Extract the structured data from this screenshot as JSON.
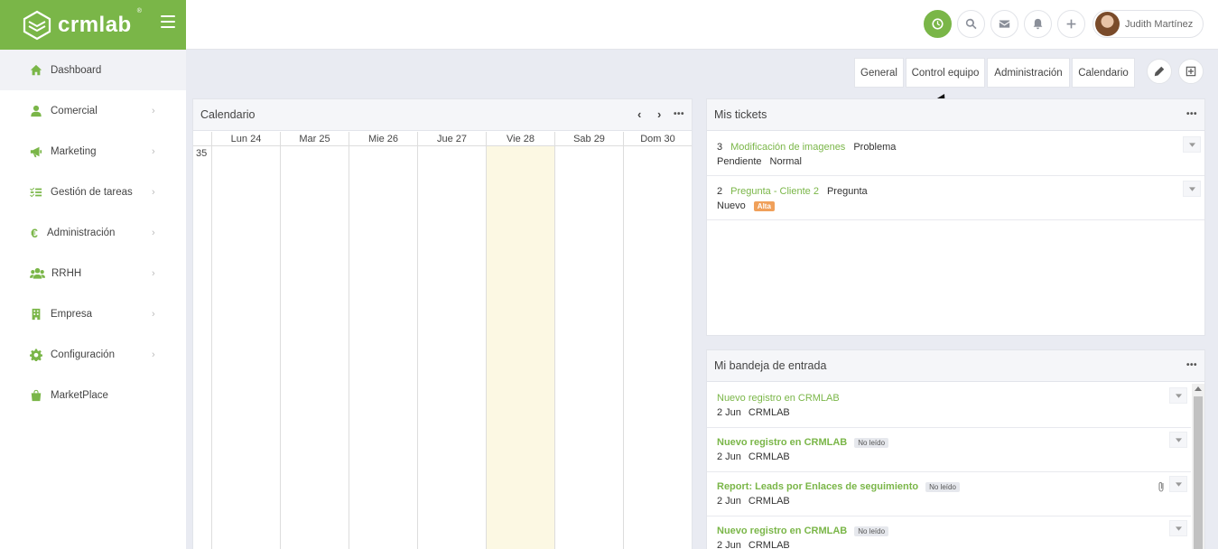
{
  "brand": {
    "name": "crmlab",
    "reg": "®"
  },
  "sidebar": {
    "items": [
      {
        "label": "Dashboard",
        "icon": "home-icon",
        "active": true,
        "chevron": false
      },
      {
        "label": "Comercial",
        "icon": "user-icon",
        "chevron": true
      },
      {
        "label": "Marketing",
        "icon": "megaphone-icon",
        "chevron": true
      },
      {
        "label": "Gestión de tareas",
        "icon": "tasks-icon",
        "chevron": true
      },
      {
        "label": "Administración",
        "icon": "euro-icon",
        "chevron": true
      },
      {
        "label": "RRHH",
        "icon": "users-icon",
        "chevron": true
      },
      {
        "label": "Empresa",
        "icon": "building-icon",
        "chevron": true
      },
      {
        "label": "Configuración",
        "icon": "gear-icon",
        "chevron": true
      },
      {
        "label": "MarketPlace",
        "icon": "bag-icon",
        "chevron": false
      }
    ]
  },
  "topbar": {
    "user_name": "Judith Martínez"
  },
  "tabs": [
    "General",
    "Control equipo",
    "Administración",
    "Calendario"
  ],
  "calendar": {
    "title": "Calendario",
    "week": "35",
    "days": [
      "Lun 24",
      "Mar 25",
      "Mie 26",
      "Jue 27",
      "Vie 28",
      "Sab 29",
      "Dom 30"
    ],
    "today_index": 4
  },
  "tickets": {
    "title": "Mis tickets",
    "items": [
      {
        "id": "3",
        "subject": "Modificación de imagenes",
        "type": "Problema",
        "status": "Pendiente",
        "priority": "Normal",
        "priority_badge": false
      },
      {
        "id": "2",
        "subject": "Pregunta - Cliente 2",
        "type": "Pregunta",
        "status": "Nuevo",
        "priority": "Alta",
        "priority_badge": true
      }
    ]
  },
  "inbox": {
    "title": "Mi bandeja de entrada",
    "items": [
      {
        "subject": "Nuevo registro en CRMLAB",
        "date": "2 Jun",
        "from": "CRMLAB",
        "unread": false,
        "badge": ""
      },
      {
        "subject": "Nuevo registro en CRMLAB",
        "date": "2 Jun",
        "from": "CRMLAB",
        "unread": true,
        "badge": "No leído"
      },
      {
        "subject": "Report: Leads por Enlaces de seguimiento",
        "date": "2 Jun",
        "from": "CRMLAB",
        "unread": true,
        "badge": "No leído",
        "attachment": true
      },
      {
        "subject": "Nuevo registro en CRMLAB",
        "date": "2 Jun",
        "from": "CRMLAB",
        "unread": true,
        "badge": "No leído"
      }
    ]
  },
  "colors": {
    "accent": "#7ab648",
    "today": "#fcf8e3",
    "alta": "#f0a05a"
  }
}
